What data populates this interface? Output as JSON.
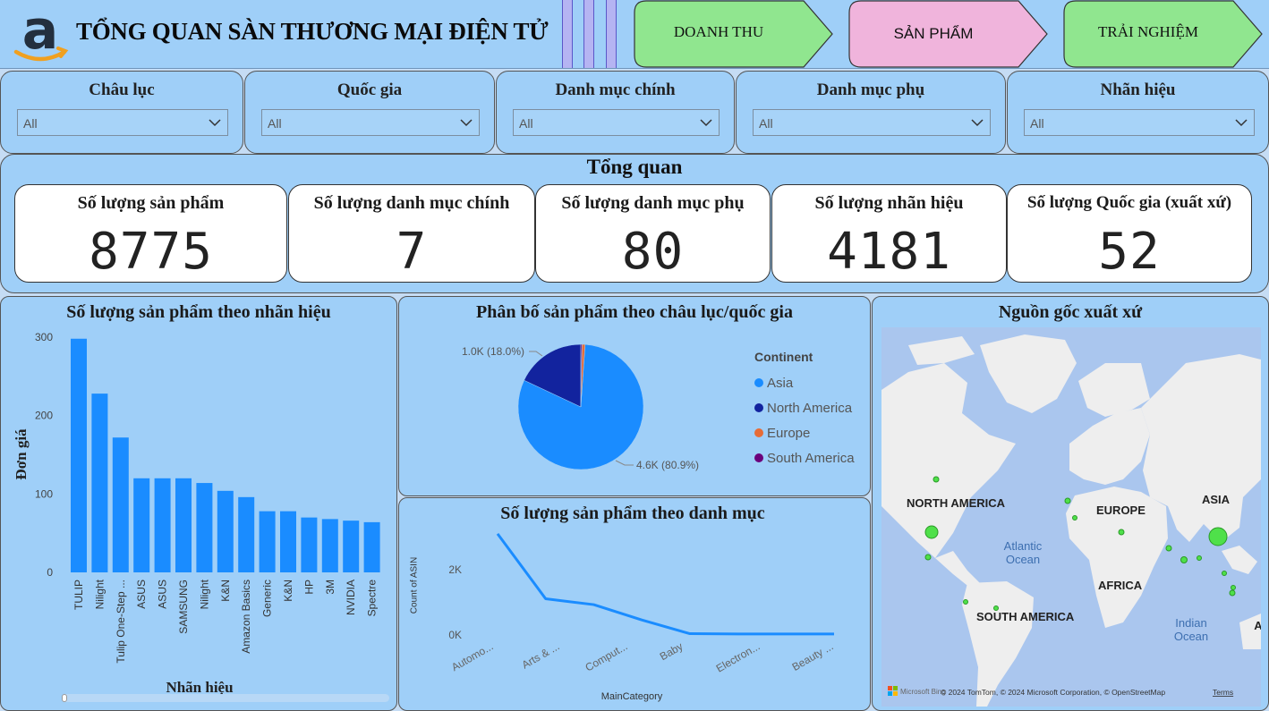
{
  "header": {
    "title": "TỔNG QUAN SÀN THƯƠNG MẠI ĐIỆN TỬ",
    "logo_icon": "amazon-logo",
    "nav": [
      {
        "label": "DOANH THU",
        "color": "#90e68f"
      },
      {
        "label": "SẢN PHẨM",
        "color": "#f0b4dc"
      },
      {
        "label": "TRẢI NGHIỆM",
        "color": "#90e68f"
      }
    ]
  },
  "filters": [
    {
      "label": "Châu lục",
      "value": "All"
    },
    {
      "label": "Quốc gia",
      "value": "All"
    },
    {
      "label": "Danh mục chính",
      "value": "All"
    },
    {
      "label": "Danh mục phụ",
      "value": "All"
    },
    {
      "label": "Nhãn hiệu",
      "value": "All"
    }
  ],
  "overview": {
    "title": "Tổng quan",
    "kpis": [
      {
        "label": "Số lượng sản phẩm",
        "value": "8775"
      },
      {
        "label": "Số lượng danh mục chính",
        "value": "7"
      },
      {
        "label": "Số lượng danh mục phụ",
        "value": "80"
      },
      {
        "label": "Số lượng nhãn hiệu",
        "value": "4181"
      },
      {
        "label": "Số lượng Quốc gia (xuất xứ)",
        "value": "52"
      }
    ]
  },
  "brand_chart": {
    "title": "Số lượng sản phẩm theo nhãn hiệu",
    "chart_data": {
      "type": "bar",
      "categories": [
        "TULIP",
        "Nilight",
        "Tulip One-Step ...",
        "ASUS",
        "ASUS",
        "SAMSUNG",
        "Nilight",
        "K&N",
        "Amazon Basics",
        "Generic",
        "K&N",
        "HP",
        "3M",
        "NVIDIA",
        "Spectre"
      ],
      "values": [
        298,
        228,
        172,
        120,
        120,
        120,
        114,
        104,
        96,
        78,
        78,
        70,
        68,
        66,
        64
      ],
      "xlabel": "Nhãn hiệu",
      "ylabel": "Đơn giá",
      "yticks": [
        "0",
        "100",
        "200",
        "300"
      ],
      "ylim": [
        0,
        300
      ],
      "color": "#1a8cff"
    }
  },
  "pie_chart": {
    "title": "Phân bố sản phẩm theo châu lục/quốc gia",
    "chart_data": {
      "type": "pie",
      "legend_title": "Continent",
      "slices": [
        {
          "name": "Asia",
          "value": 80.9,
          "color": "#1a8cff"
        },
        {
          "name": "North America",
          "value": 18.0,
          "color": "#12239e"
        },
        {
          "name": "Europe",
          "value": 0.8,
          "color": "#e66c37"
        },
        {
          "name": "South America",
          "value": 0.3,
          "color": "#6b007b"
        }
      ],
      "labels": [
        "4.6K (80.9%)",
        "1.0K (18.0%)"
      ]
    }
  },
  "category_chart": {
    "title": "Số lượng sản phẩm theo danh mục",
    "chart_data": {
      "type": "line",
      "categories": [
        "Automo...",
        "Arts & ...",
        "Comput...",
        "Baby",
        "Electron...",
        "Beauty ..."
      ],
      "x_points": [
        0,
        1,
        2,
        3,
        4,
        5,
        6,
        7
      ],
      "values": [
        3100,
        1110,
        930,
        460,
        40,
        30,
        30,
        30
      ],
      "xlabel": "MainCategory",
      "ylabel": "Count of ASIN",
      "yticks": [
        "0K",
        "2K"
      ],
      "ylim": [
        0,
        3400
      ],
      "color": "#1a8cff"
    }
  },
  "map": {
    "title": "Nguồn gốc xuất xứ",
    "labels": [
      "NORTH AMERICA",
      "EUROPE",
      "ASIA",
      "AFRICA",
      "SOUTH AMERICA",
      "Atlantic",
      "Ocean",
      "Indian",
      "Ocean",
      "A"
    ],
    "attribution": "© 2024 TomTom, © 2024 Microsoft Corporation, © OpenStreetMap",
    "terms": "Terms",
    "provider": "Microsoft Bing",
    "bubble_color": "#4fe04a"
  }
}
